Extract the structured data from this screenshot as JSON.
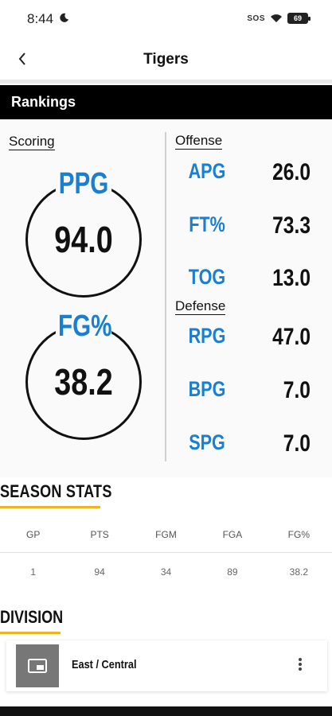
{
  "status": {
    "time": "8:44",
    "sos": "SOS",
    "battery": "69"
  },
  "header": {
    "title": "Tigers"
  },
  "rankings": {
    "title": "Rankings",
    "scoring_label": "Scoring",
    "offense_label": "Offense",
    "defense_label": "Defense",
    "scoring": [
      {
        "abbr": "PPG",
        "value": "94.0"
      },
      {
        "abbr": "FG%",
        "value": "38.2"
      }
    ],
    "offense": [
      {
        "abbr": "APG",
        "value": "26.0"
      },
      {
        "abbr": "FT%",
        "value": "73.3"
      },
      {
        "abbr": "TOG",
        "value": "13.0"
      }
    ],
    "defense": [
      {
        "abbr": "RPG",
        "value": "47.0"
      },
      {
        "abbr": "BPG",
        "value": "7.0"
      },
      {
        "abbr": "SPG",
        "value": "7.0"
      }
    ],
    "accent_color": "#1a7fd0"
  },
  "season_stats": {
    "title": "SEASON STATS",
    "columns": [
      "GP",
      "PTS",
      "FGM",
      "FGA",
      "FG%"
    ],
    "row": [
      "1",
      "94",
      "34",
      "89",
      "38.2"
    ]
  },
  "division": {
    "title": "DIVISION",
    "name": "East / Central",
    "icon": "picture-in-picture-icon"
  },
  "colors": {
    "underline": "#f0b323",
    "header_bg": "#000000"
  }
}
